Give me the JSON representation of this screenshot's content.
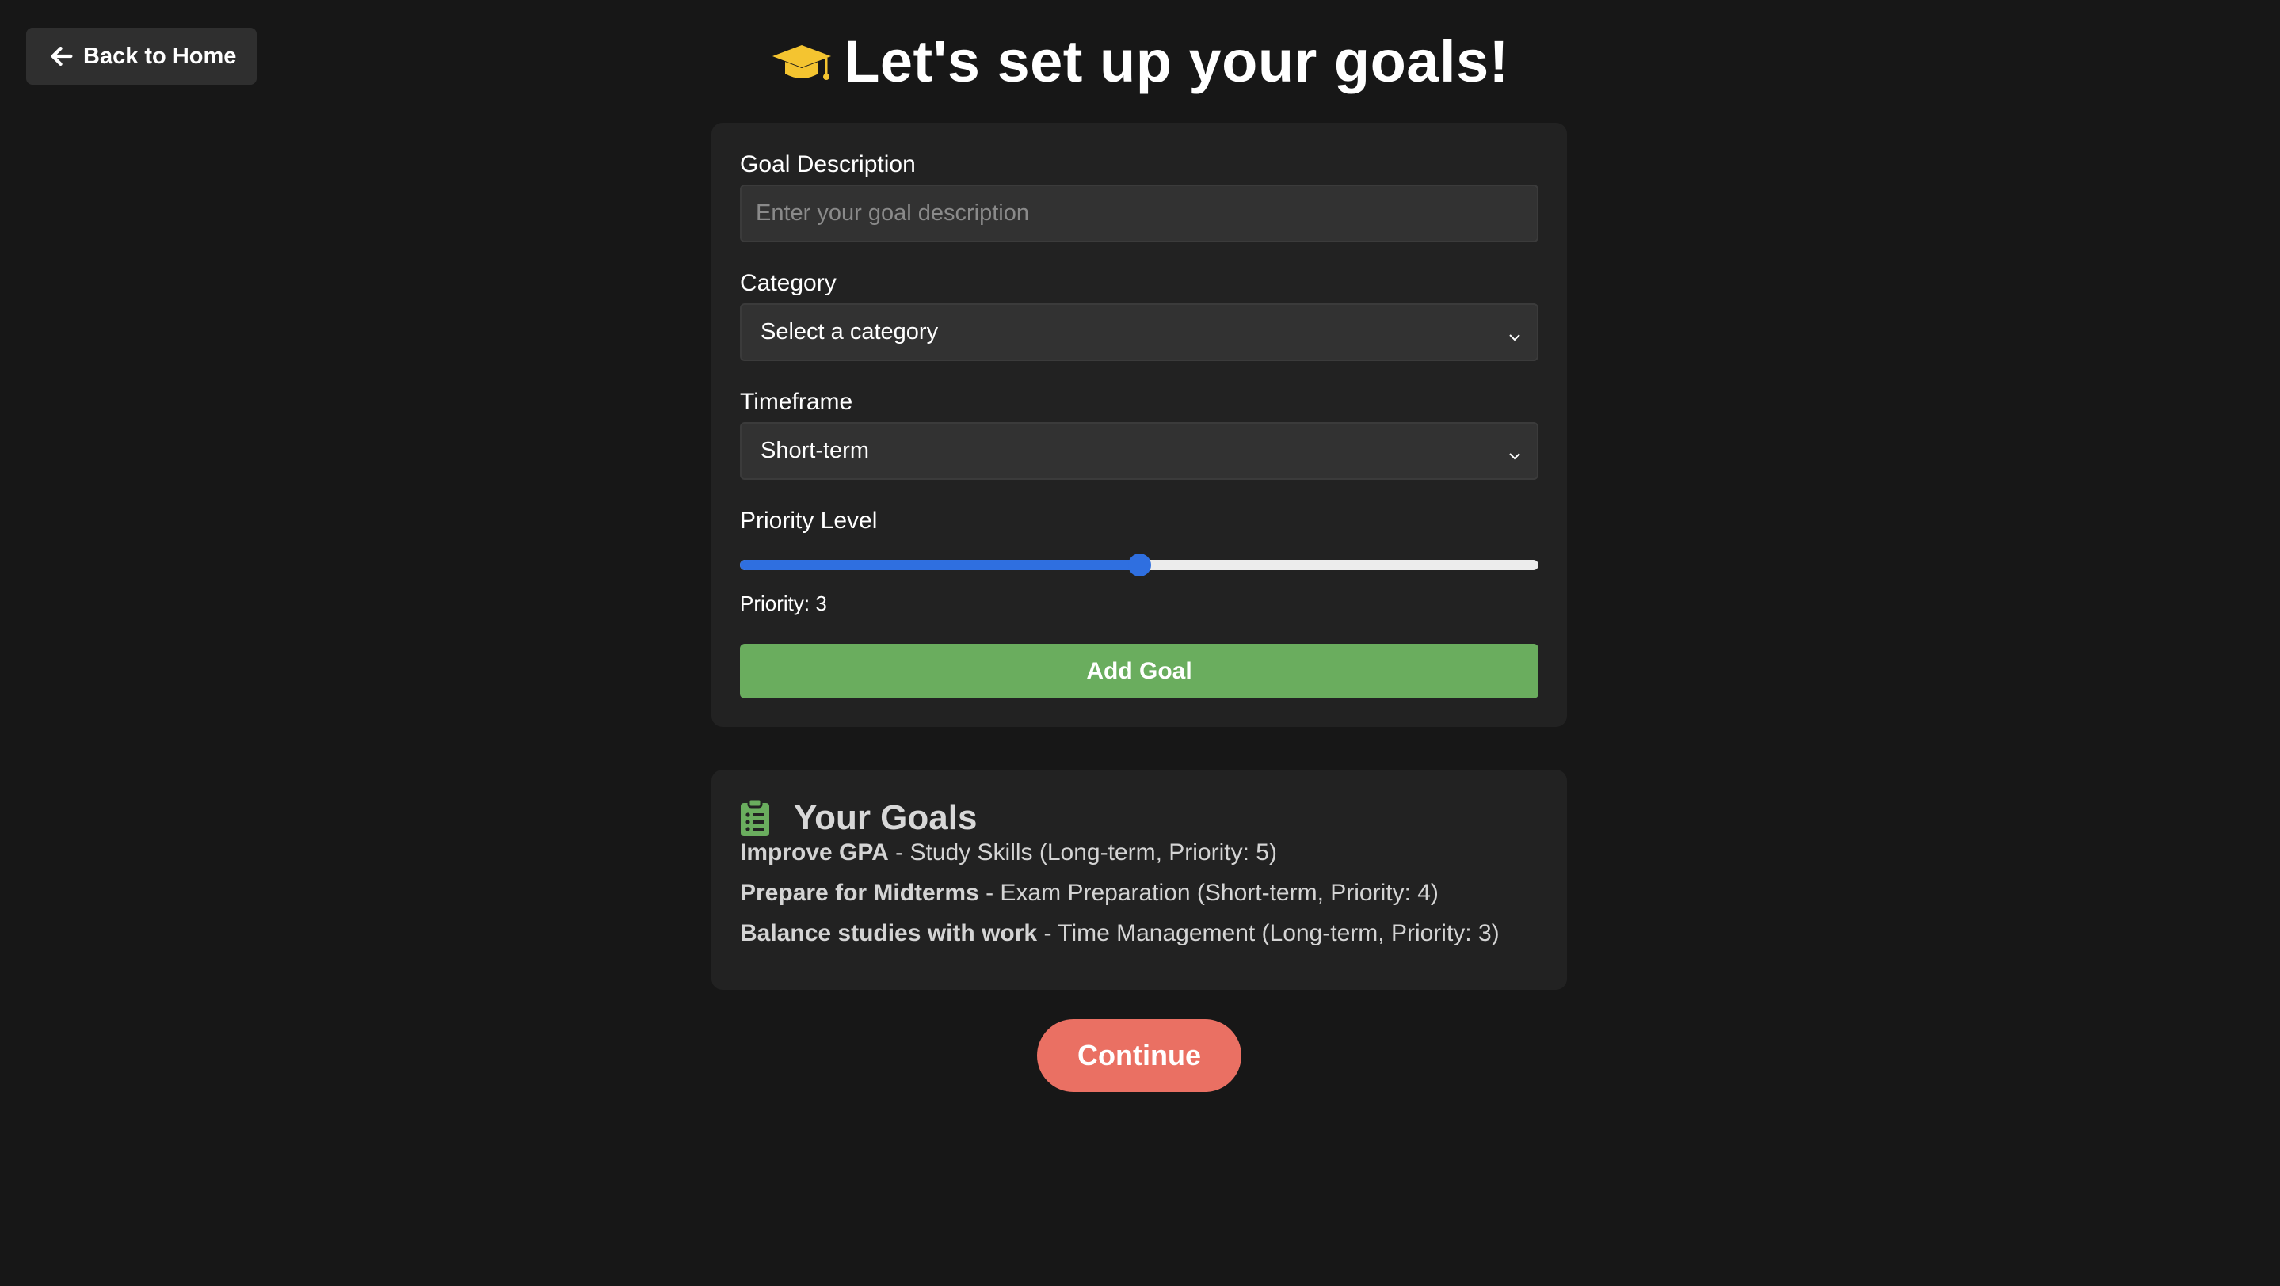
{
  "nav": {
    "back_label": "Back to Home",
    "back_icon": "arrow-left-icon"
  },
  "header": {
    "title": "Let's set up your goals!",
    "icon": "graduation-cap-icon",
    "icon_color": "#f4c430"
  },
  "form": {
    "goal_description": {
      "label": "Goal Description",
      "placeholder": "Enter your goal description",
      "value": ""
    },
    "category": {
      "label": "Category",
      "selected": "Select a category"
    },
    "timeframe": {
      "label": "Timeframe",
      "selected": "Short-term"
    },
    "priority": {
      "label": "Priority Level",
      "value": 3,
      "min": 1,
      "max": 5,
      "readout": "Priority: 3"
    },
    "add_button_label": "Add Goal"
  },
  "goals": {
    "title": "Your Goals",
    "icon": "clipboard-list-icon",
    "icon_color": "#6aad5e",
    "items": [
      {
        "name": "Improve GPA",
        "detail": " - Study Skills (Long-term, Priority: 5)"
      },
      {
        "name": "Prepare for Midterms",
        "detail": " - Exam Preparation (Short-term, Priority: 4)"
      },
      {
        "name": "Balance studies with work",
        "detail": " - Time Management (Long-term, Priority: 3)"
      }
    ]
  },
  "continue_label": "Continue",
  "colors": {
    "background": "#171717",
    "card": "#222222",
    "accent_green": "#6aad5e",
    "accent_coral": "#ea7063",
    "slider_blue": "#2f6fe0"
  }
}
